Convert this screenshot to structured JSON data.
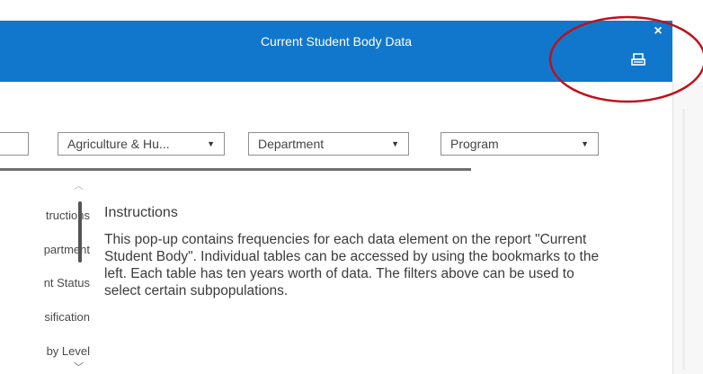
{
  "dialog": {
    "title": "Current Student Body Data",
    "close_label": "×"
  },
  "filters": {
    "partial_value": "]",
    "college_value": "Agriculture & Hu...",
    "department_value": "Department",
    "program_value": "Program",
    "caret": "▼"
  },
  "nav": {
    "scroll_up": "︿",
    "scroll_down": "﹀",
    "items": [
      {
        "label": "tructions"
      },
      {
        "label": "partment"
      },
      {
        "label": "nt Status"
      },
      {
        "label": "sification"
      },
      {
        "label": "by Level"
      }
    ]
  },
  "content": {
    "title": "Instructions",
    "body": "This pop-up contains frequencies for each data element on the report \"Current Student Body\".  Individual tables can be accessed by using the bookmarks to the left. Each table has ten years worth of data. The filters above can be used to select certain subpopulations."
  },
  "icons": {
    "print": "printer-icon",
    "close": "close-icon",
    "annotation": "red-ellipse-annotation"
  },
  "colors": {
    "header": "#1177cc",
    "annotation": "#c0101a"
  }
}
